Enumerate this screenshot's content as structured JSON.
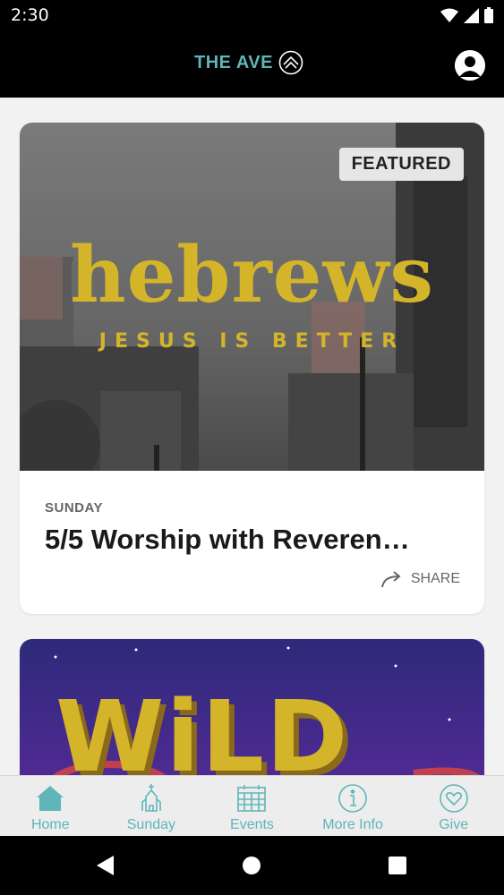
{
  "status_bar": {
    "time": "2:30"
  },
  "header": {
    "logo_text": "THE AVE"
  },
  "cards": [
    {
      "badge": "FEATURED",
      "image_title": "hebrews",
      "image_subtitle": "JESUS IS BETTER",
      "category": "SUNDAY",
      "title": "5/5 Worship with Reveren…",
      "share_label": "SHARE"
    },
    {
      "image_title": "WiLD"
    }
  ],
  "tabs": [
    {
      "label": "Home",
      "icon": "home-icon"
    },
    {
      "label": "Sunday",
      "icon": "church-icon"
    },
    {
      "label": "Events",
      "icon": "calendar-icon"
    },
    {
      "label": "More Info",
      "icon": "info-icon"
    },
    {
      "label": "Give",
      "icon": "heart-icon"
    }
  ],
  "colors": {
    "accent": "#5fb5b8",
    "title_yellow": "#d4b52a"
  }
}
